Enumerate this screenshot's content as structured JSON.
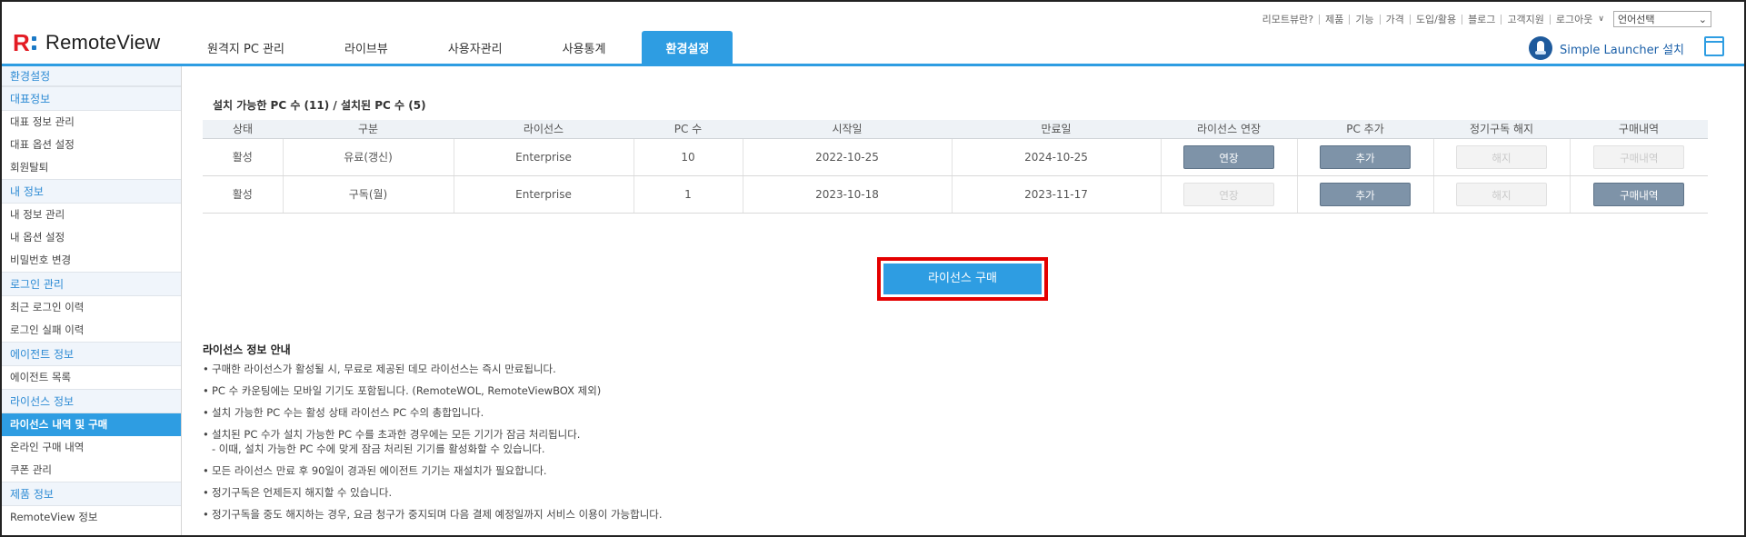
{
  "header": {
    "logo_text": "RemoteView",
    "top_links": [
      "리모트뷰란?",
      "제품",
      "기능",
      "가격",
      "도입/활용",
      "블로그",
      "고객지원",
      "로그아웃"
    ],
    "language_select": "언어선택",
    "nav_tabs": [
      "원격지 PC 관리",
      "라이브뷰",
      "사용자관리",
      "사용통계",
      "환경설정"
    ],
    "active_tab": "환경설정",
    "launcher_label": "Simple Launcher 설치"
  },
  "sidebar": {
    "title": "환경설정",
    "sections": [
      {
        "label": "대표정보",
        "items": [
          "대표 정보 관리",
          "대표 옵션 설정",
          "회원탈퇴"
        ]
      },
      {
        "label": "내 정보",
        "items": [
          "내 정보 관리",
          "내 옵션 설정",
          "비밀번호 변경"
        ]
      },
      {
        "label": "로그인 관리",
        "items": [
          "최근 로그인 이력",
          "로그인 실패 이력"
        ]
      },
      {
        "label": "에이전트 정보",
        "items": [
          "에이전트 목록"
        ]
      },
      {
        "label": "라이선스 정보",
        "items": [
          "라이선스 내역 및 구매",
          "온라인 구매 내역",
          "쿠폰 관리"
        ]
      },
      {
        "label": "제품 정보",
        "items": [
          "RemoteView 정보"
        ]
      }
    ],
    "active_item": "라이선스 내역 및 구매"
  },
  "main": {
    "summary": "설치 가능한 PC 수 (11) / 설치된 PC 수 (5)",
    "table": {
      "headers": [
        "상태",
        "구분",
        "라이선스",
        "PC 수",
        "시작일",
        "만료일",
        "라이선스 연장",
        "PC 추가",
        "정기구독 해지",
        "구매내역"
      ],
      "rows": [
        {
          "status": "활성",
          "type": "유료(갱신)",
          "license": "Enterprise",
          "pc_count": "10",
          "start": "2022-10-25",
          "end": "2024-10-25",
          "extend": {
            "label": "연장",
            "enabled": true
          },
          "add_pc": {
            "label": "추가",
            "enabled": true
          },
          "cancel": {
            "label": "해지",
            "enabled": false
          },
          "history": {
            "label": "구매내역",
            "enabled": false
          }
        },
        {
          "status": "활성",
          "type": "구독(월)",
          "license": "Enterprise",
          "pc_count": "1",
          "start": "2023-10-18",
          "end": "2023-11-17",
          "extend": {
            "label": "연장",
            "enabled": false
          },
          "add_pc": {
            "label": "추가",
            "enabled": true
          },
          "cancel": {
            "label": "해지",
            "enabled": false
          },
          "history": {
            "label": "구매내역",
            "enabled": true
          }
        }
      ]
    },
    "buy_button": "라이선스 구매",
    "guide_title": "라이선스 정보 안내",
    "guide": [
      "구매한 라이선스가 활성될 시, 무료로 제공된 데모 라이선스는 즉시 만료됩니다.",
      "PC 수 카운팅에는 모바일 기기도 포함됩니다. (RemoteWOL, RemoteViewBOX 제외)",
      "설치 가능한 PC 수는 활성 상태 라이선스 PC 수의 총합입니다.",
      "설치된 PC 수가 설치 가능한 PC 수를 초과한 경우에는 모든 기기가 잠금 처리됩니다.",
      "모든 라이선스 만료 후 90일이 경과된 에이전트 기기는 재설치가 필요합니다.",
      "정기구독은 언제든지 해지할 수 있습니다.",
      "정기구독을 중도 해지하는 경우, 요금 청구가 중지되며 다음 결제 예정일까지 서비스 이용이 가능합니다."
    ],
    "guide_sub": "- 이때, 설치 가능한 PC 수에 맞게 잠금 처리된 기기를 활성화할 수 있습니다."
  },
  "colors": {
    "accent": "#2e9de2",
    "brand_red": "#e31b23",
    "highlight_border": "#e40000",
    "button_active": "#7e93a8"
  }
}
